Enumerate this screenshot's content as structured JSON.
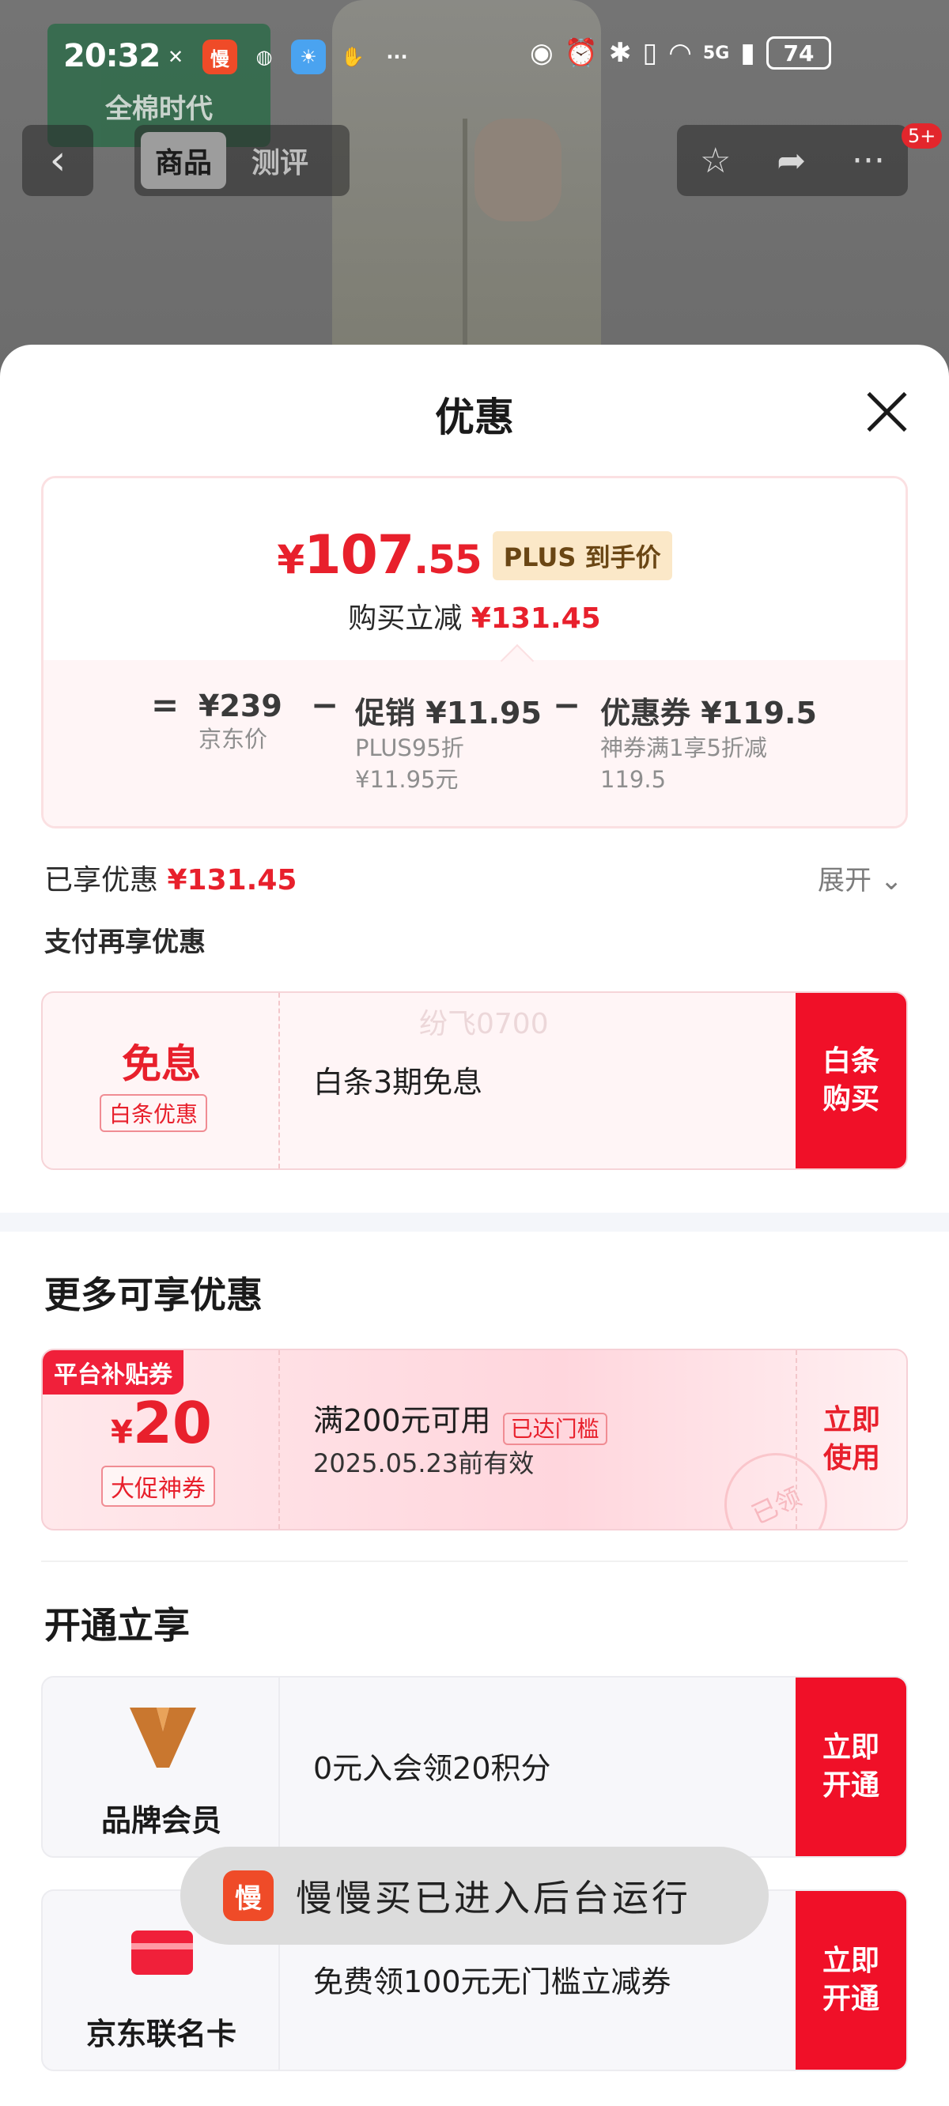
{
  "status_bar": {
    "time": "20:32",
    "app_badge": "慢",
    "signal_label": "5G",
    "battery": "74"
  },
  "background": {
    "badge_text": "全棉时代"
  },
  "nav": {
    "back": "‹",
    "tabs": [
      {
        "label": "商品",
        "active": true
      },
      {
        "label": "测评",
        "active": false
      }
    ],
    "star": "☆",
    "share": "➦",
    "more": "···",
    "notification_count": "5+"
  },
  "sheet": {
    "title": "优惠",
    "price": {
      "currency": "¥",
      "integer": "107",
      "decimal": ".55",
      "tag": "PLUS 到手价",
      "reduce_label": "购买立减",
      "reduce_amount": "¥131.45"
    },
    "equation": {
      "equals": "=",
      "minus": "−",
      "jd_price": "¥239",
      "jd_label": "京东价",
      "promo_label": "促销",
      "promo_amount": "¥11.95",
      "promo_sub1": "PLUS95折",
      "promo_sub2": "¥11.95元",
      "coupon_label": "优惠券",
      "coupon_amount": "¥119.5",
      "coupon_sub1": "神券满1享5折减",
      "coupon_sub2": "119.5"
    },
    "enjoyed_label": "已享优惠",
    "enjoyed_amount": "¥131.45",
    "expand_label": "展开",
    "pay_more_title": "支付再享优惠",
    "baitiao": {
      "title": "免息",
      "tag": "白条优惠",
      "desc": "白条3期免息",
      "watermark": "纷飞0700",
      "button": "白条\n购买"
    },
    "more_title": "更多可享优惠",
    "platform_coupon": {
      "tag": "平台补贴券",
      "currency": "¥",
      "amount": "20",
      "sub": "大促神券",
      "condition": "满200元可用",
      "badge": "已达门槛",
      "valid": "2025.05.23前有效",
      "stamp": "已领",
      "button": "立即\n使用"
    },
    "open_title": "开通立享",
    "brand_member": {
      "label": "品牌会员",
      "desc": "0元入会领20积分",
      "button": "立即\n开通"
    },
    "jd_card": {
      "label": "京东联名卡",
      "desc": "免费领100元无门槛立减券",
      "button": "立即\n开通"
    }
  },
  "toast": {
    "icon_text": "慢",
    "text": "慢慢买已进入后台运行"
  },
  "colors": {
    "accent_red": "#e8202c",
    "button_red": "#f01028",
    "plus_gold": "#fbe8c8"
  }
}
